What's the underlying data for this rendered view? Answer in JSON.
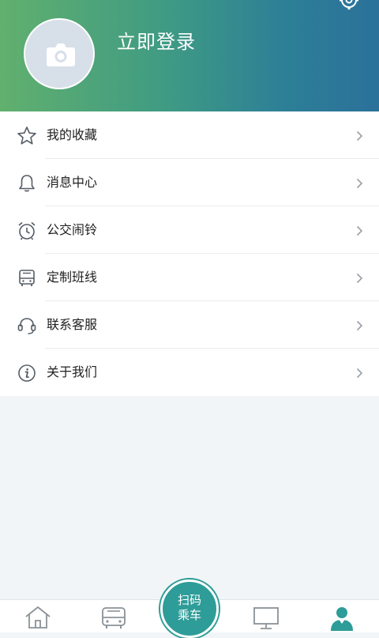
{
  "header": {
    "login_label": "立即登录",
    "gradient_start": "#61b06e",
    "gradient_end": "#2b719a"
  },
  "menu": {
    "items": [
      {
        "label": "我的收藏",
        "icon": "star-icon"
      },
      {
        "label": "消息中心",
        "icon": "bell-icon"
      },
      {
        "label": "公交闹铃",
        "icon": "alarm-clock-icon"
      },
      {
        "label": "定制班线",
        "icon": "bus-front-icon"
      },
      {
        "label": "联系客服",
        "icon": "headset-icon"
      },
      {
        "label": "关于我们",
        "icon": "info-icon"
      }
    ]
  },
  "tabbar": {
    "scan_line1": "扫码",
    "scan_line2": "乘车",
    "accent_color": "#2e9c98",
    "tabs": [
      {
        "icon": "home-icon",
        "active": false
      },
      {
        "icon": "bus-icon",
        "active": false
      },
      {
        "icon": "scan-ride-button",
        "active": false
      },
      {
        "icon": "monitor-icon",
        "active": false
      },
      {
        "icon": "user-icon",
        "active": true
      }
    ]
  }
}
